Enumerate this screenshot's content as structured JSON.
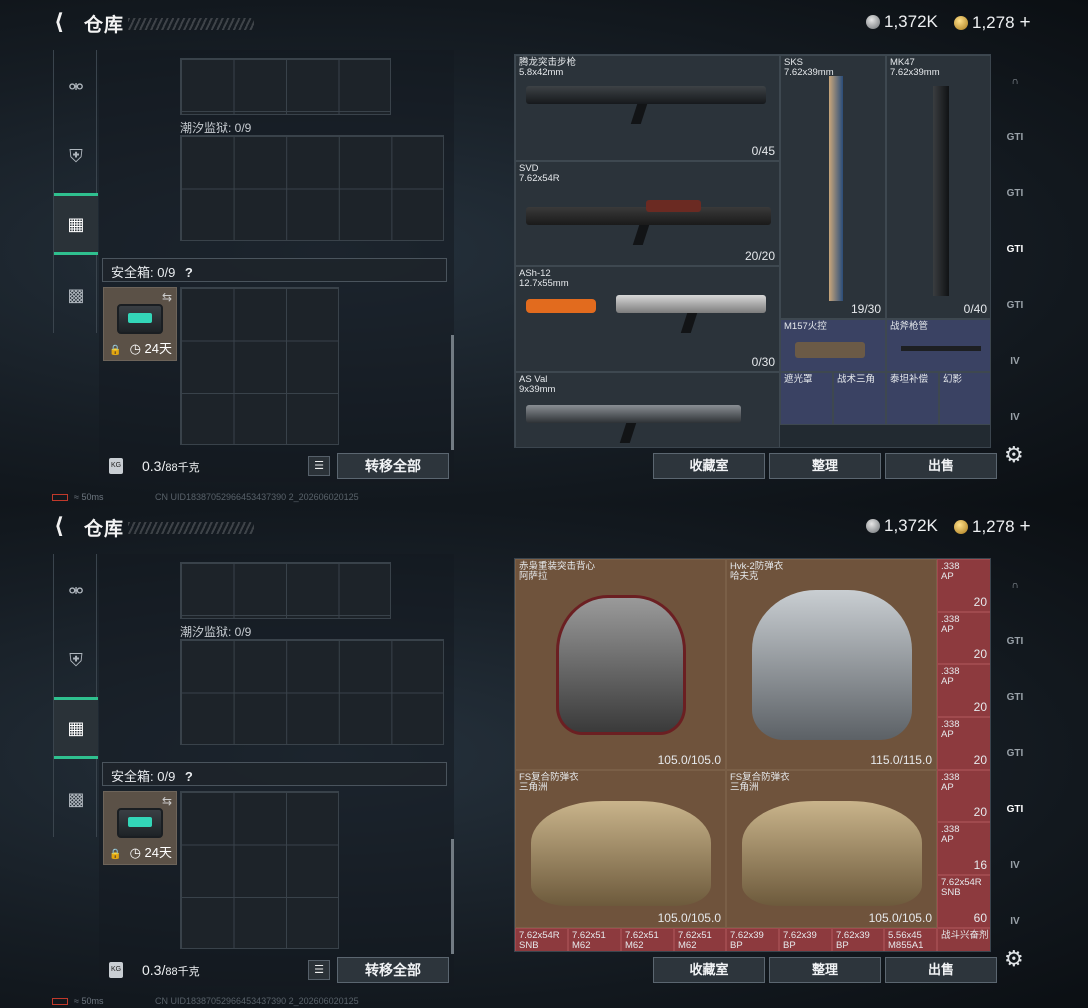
{
  "header": {
    "back_icon": "back-arrow-icon",
    "title": "仓库",
    "currency1": "1,372K",
    "currency2": "1,278",
    "plus": "+"
  },
  "left": {
    "grid_label": "潮汐监狱: 0/9",
    "safe_box": "安全箱: 0/9",
    "help": "?",
    "case_time": "24天",
    "weight": "0.3/",
    "weight_cap": "88千克",
    "transfer_all": "转移全部"
  },
  "rail": {
    "items": [
      "pistol-icon",
      "helmet-icon",
      "backpack-icon",
      "toolbox-icon"
    ]
  },
  "panel_buttons": {
    "collection": "收藏室",
    "sort": "整理",
    "sell": "出售"
  },
  "status": {
    "ping": "50ms",
    "uid": "CN UID18387052966453437390 2_202606020125"
  },
  "s1_items": [
    {
      "name": "腾龙突击步枪\n5.8x42mm",
      "count": "0/45"
    },
    {
      "name": "SVD\n7.62x54R",
      "count": "20/20"
    },
    {
      "name": "ASh-12\n12.7x55mm",
      "count": "0/30"
    },
    {
      "name": "AS Val\n9x39mm",
      "count": ""
    },
    {
      "name": "SKS\n7.62x39mm",
      "count": "19/30"
    },
    {
      "name": "MK47\n7.62x39mm",
      "count": "0/40"
    },
    {
      "name": "M157火控",
      "count": ""
    },
    {
      "name": "战斧枪管",
      "count": ""
    },
    {
      "name": "遮光罩",
      "count": ""
    },
    {
      "name": "战术三角",
      "count": ""
    },
    {
      "name": "泰坦补偿",
      "count": ""
    },
    {
      "name": "幻影",
      "count": ""
    }
  ],
  "s2_items": [
    {
      "name": "赤枭重装突击背心\n阿萨拉",
      "count": "105.0/105.0"
    },
    {
      "name": "Hvk-2防弹衣\n哈夫克",
      "count": "115.0/115.0"
    },
    {
      "name": "FS复合防弹衣\n三角洲",
      "count": "105.0/105.0"
    },
    {
      "name": "FS复合防弹衣\n三角洲",
      "count": "105.0/105.0"
    }
  ],
  "s2_ammo": [
    {
      "name": ".338\nAP",
      "count": "20"
    },
    {
      "name": ".338\nAP",
      "count": "20"
    },
    {
      "name": ".338\nAP",
      "count": "20"
    },
    {
      "name": ".338\nAP",
      "count": "20"
    },
    {
      "name": ".338\nAP",
      "count": "20"
    },
    {
      "name": ".338\nAP",
      "count": "16"
    },
    {
      "name": "7.62x54R\nSNB",
      "count": "60"
    }
  ],
  "s2_bottom_row": [
    "7.62x54R",
    "7.62x51",
    "7.62x51",
    "7.62x51",
    "7.62x39",
    "7.62x39",
    "7.62x39",
    "5.56x45",
    "战斗兴奋剂"
  ],
  "s2_bottom_sub": [
    "SNB",
    "M62",
    "M62",
    "M62",
    "BP",
    "BP",
    "BP",
    "M855A1",
    ""
  ]
}
